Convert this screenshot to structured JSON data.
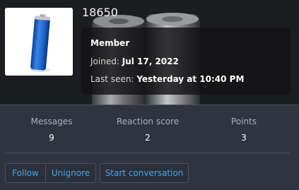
{
  "profile": {
    "username": "18650",
    "role": "Member",
    "joined_label": "Joined:",
    "joined_value": "Jul 17, 2022",
    "last_seen_label": "Last seen:",
    "last_seen_value": "Yesterday at 10:40 PM"
  },
  "stats": {
    "messages_label": "Messages",
    "messages_value": "9",
    "reactions_label": "Reaction score",
    "reactions_value": "2",
    "points_label": "Points",
    "points_value": "3"
  },
  "actions": {
    "follow": "Follow",
    "unignore": "Unignore",
    "start_conversation": "Start conversation"
  },
  "colors": {
    "link": "#4aa3e8",
    "stats_bg": "#2f3440",
    "battery_blue": "#1e63c8"
  }
}
